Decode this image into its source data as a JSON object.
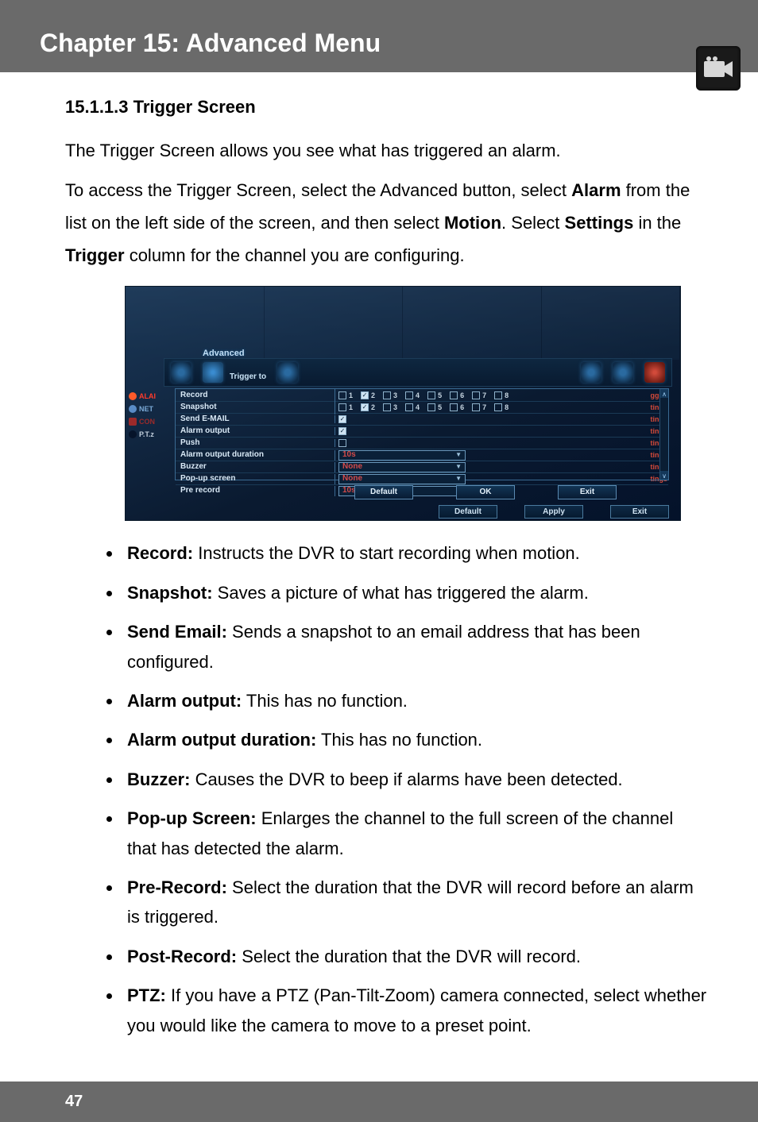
{
  "header": {
    "title": "Chapter 15: Advanced Menu"
  },
  "section": {
    "heading": "15.1.1.3 Trigger Screen",
    "p1": "The Trigger Screen allows you see what has triggered an alarm.",
    "p2_a": "To access the Trigger Screen, select the Advanced button, select ",
    "p2_b": "Alarm",
    "p2_c": " from the list on the left side of the screen, and then select ",
    "p2_d": "Motion",
    "p2_e": ". Select ",
    "p2_f": "Settings",
    "p2_g": " in the ",
    "p2_h": "Trigger",
    "p2_i": " column for the channel you are configuring."
  },
  "bullets": {
    "record_k": "Record:",
    "record_v": " Instructs the DVR to start recording when motion.",
    "snapshot_k": "Snapshot:",
    "snapshot_v": " Saves a picture of what has triggered the alarm.",
    "sendemail_k": "Send Email:",
    "sendemail_v": " Sends a snapshot to an email address that has been configured.",
    "alarmout_k": "Alarm output:",
    "alarmout_v": " This has no function.",
    "alarmoutdur_k": "Alarm output duration:",
    "alarmoutdur_v": " This has no function.",
    "buzzer_k": "Buzzer:",
    "buzzer_v": " Causes the DVR to beep if alarms have been detected.",
    "popup_k": "Pop-up Screen:",
    "popup_v": " Enlarges the channel to the full screen of the channel that has detected the alarm.",
    "prerec_k": "Pre-Record:",
    "prerec_v": " Select the duration that the DVR will record before an alarm is triggered.",
    "postrec_k": "Post-Record:",
    "postrec_v": " Select the duration that the DVR will record.",
    "ptz_k": "PTZ:",
    "ptz_v": " If you have a PTZ (Pan-Tilt-Zoom) camera connected, select whether you would like the camera to move to a preset point."
  },
  "dvr": {
    "advanced": "Advanced",
    "trigger_to": "Trigger to",
    "side": {
      "alai": "ALAI",
      "net": "NET",
      "con": "CON",
      "ptz": "P.T.z"
    },
    "rows": {
      "record": "Record",
      "snapshot": "Snapshot",
      "sendemail": "Send E-MAIL",
      "alarmoutput": "Alarm output",
      "push": "Push",
      "alarmoutputdur": "Alarm output duration",
      "buzzer": "Buzzer",
      "popup": "Pop-up screen",
      "prerecord": "Pre record"
    },
    "channels": [
      "1",
      "2",
      "3",
      "4",
      "5",
      "6",
      "7",
      "8"
    ],
    "record_checked": [
      false,
      true,
      false,
      false,
      false,
      false,
      false,
      false
    ],
    "snapshot_checked": [
      false,
      true,
      false,
      false,
      false,
      false,
      false,
      false
    ],
    "sendemail_checked": true,
    "alarmoutput_checked": true,
    "push_checked": false,
    "sel_alarmdur": "10s",
    "sel_buzzer": "None",
    "sel_popup": "None",
    "sel_prerecord": "10s",
    "rtext": [
      "gger",
      "tings",
      "tings",
      "tings",
      "tings",
      "tings",
      "tings",
      "tings"
    ],
    "panel_btns": {
      "default": "Default",
      "ok": "OK",
      "exit": "Exit"
    },
    "outer_btns": {
      "default": "Default",
      "apply": "Apply",
      "exit": "Exit"
    }
  },
  "footer": {
    "page": "47"
  }
}
